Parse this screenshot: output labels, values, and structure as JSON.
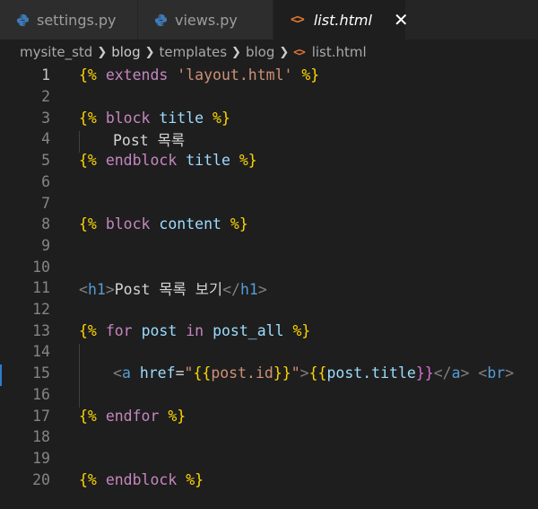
{
  "tabs": [
    {
      "label": "settings.py",
      "icon": "python-icon",
      "active": false
    },
    {
      "label": "views.py",
      "icon": "python-icon",
      "active": false
    },
    {
      "label": "list.html",
      "icon": "html-icon",
      "active": true
    }
  ],
  "close_glyph": "✕",
  "breadcrumb": [
    "mysite_std",
    "blog",
    "templates",
    "blog",
    "list.html"
  ],
  "line_numbers": [
    "1",
    "2",
    "3",
    "4",
    "5",
    "6",
    "7",
    "8",
    "9",
    "10",
    "11",
    "12",
    "13",
    "14",
    "15",
    "16",
    "17",
    "18",
    "19",
    "20"
  ],
  "code": {
    "l1": {
      "open": "{%",
      "kw": "extends",
      "str": "'layout.html'",
      "close": "%}"
    },
    "l3": {
      "open": "{%",
      "kw": "block",
      "name": "title",
      "close": "%}"
    },
    "l4": {
      "text": "Post 목록"
    },
    "l5": {
      "open": "{%",
      "kw": "endblock",
      "name": "title",
      "close": "%}"
    },
    "l8": {
      "open": "{%",
      "kw": "block",
      "name": "content",
      "close": "%}"
    },
    "l11": {
      "lt": "<",
      "tag": "h1",
      "gt": ">",
      "text": "Post 목록 보기",
      "lt2": "</",
      "tag2": "h1",
      "gt2": ">"
    },
    "l13": {
      "open": "{%",
      "kw": "for",
      "var1": "post",
      "kw2": "in",
      "var2": "post_all",
      "close": "%}"
    },
    "l15": {
      "lt": "<",
      "tag": "a",
      "attr": "href",
      "eq": "=",
      "q1": "\"",
      "o1": "{{",
      "val1": "post.id",
      "c1": "}}",
      "q2": "\"",
      "gt": ">",
      "o2": "{{",
      "val2": "post.title",
      "c2": "}}",
      "lt2": "</",
      "tag2": "a",
      "gt2": ">",
      "lt3": "<",
      "tag3": "br",
      "gt3": ">"
    },
    "l17": {
      "open": "{%",
      "kw": "endfor",
      "close": "%}"
    },
    "l20": {
      "open": "{%",
      "kw": "endblock",
      "close": "%}"
    }
  }
}
